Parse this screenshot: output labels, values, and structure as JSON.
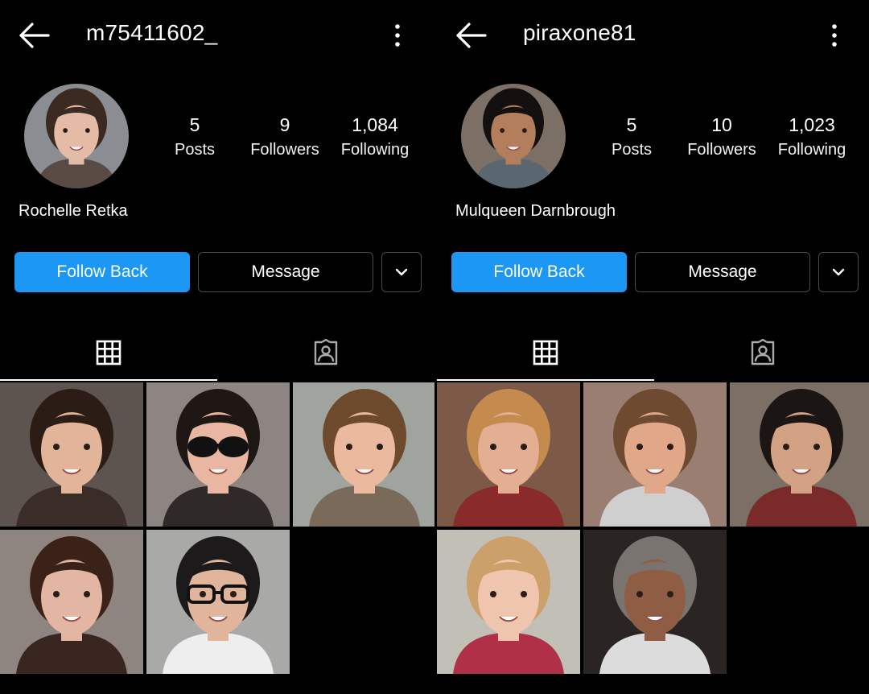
{
  "profiles": [
    {
      "username": "m75411602_",
      "display_name": "Rochelle Retka",
      "stats": [
        {
          "value": "5",
          "label": "Posts"
        },
        {
          "value": "9",
          "label": "Followers"
        },
        {
          "value": "1,084",
          "label": "Following"
        }
      ],
      "buttons": {
        "follow": "Follow Back",
        "message": "Message"
      },
      "avatar": {
        "bg": "#8a8d92",
        "skin": "#e3bba7",
        "hair": "#3a2a22",
        "shirt": "#5a4a44"
      },
      "photos": [
        {
          "bg": "#5d5450",
          "skin": "#e2b49a",
          "hair": "#2b1c16",
          "shirt": "#3a2c27",
          "glasses": "none"
        },
        {
          "bg": "#8c8582",
          "skin": "#e8b6a1",
          "hair": "#1f1714",
          "shirt": "#2f2a28",
          "glasses": "sunglasses"
        },
        {
          "bg": "#9fa49e",
          "skin": "#eab99e",
          "hair": "#6e4a2c",
          "shirt": "#7a6a5a",
          "glasses": "none"
        },
        {
          "bg": "#8f8580",
          "skin": "#e2b6a2",
          "hair": "#3a2218",
          "shirt": "#3a2620",
          "glasses": "none"
        },
        {
          "bg": "#a9a9a7",
          "skin": "#e1b49c",
          "hair": "#1c1a1a",
          "shirt": "#eeeeee",
          "glasses": "glasses"
        }
      ]
    },
    {
      "username": "piraxone81",
      "display_name": "Mulqueen Darnbrough",
      "stats": [
        {
          "value": "5",
          "label": "Posts"
        },
        {
          "value": "10",
          "label": "Followers"
        },
        {
          "value": "1,023",
          "label": "Following"
        }
      ],
      "buttons": {
        "follow": "Follow Back",
        "message": "Message"
      },
      "avatar": {
        "bg": "#7b6f66",
        "skin": "#b27e5c",
        "hair": "#141010",
        "shirt": "#5a6670"
      },
      "photos": [
        {
          "bg": "#7d5a48",
          "skin": "#e3ae92",
          "hair": "#c48a4e",
          "shirt": "#8b2a2a",
          "glasses": "none"
        },
        {
          "bg": "#9a7e72",
          "skin": "#e0a888",
          "hair": "#6d4a30",
          "shirt": "#cfcfcf",
          "glasses": "none"
        },
        {
          "bg": "#7c6f66",
          "skin": "#d3a184",
          "hair": "#1b1614",
          "shirt": "#7a2a28",
          "glasses": "none"
        },
        {
          "bg": "#c2c0b6",
          "skin": "#efc6ad",
          "hair": "#cca06a",
          "shirt": "#b03048",
          "glasses": "none"
        },
        {
          "bg": "#2a2522",
          "skin": "#8e5d43",
          "hair": "#7a7470",
          "shirt": "#dcdcdc",
          "glasses": "none"
        }
      ]
    }
  ]
}
